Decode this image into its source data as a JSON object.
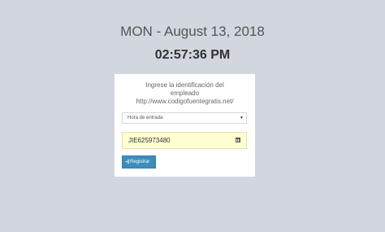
{
  "clock": {
    "date": "MON - August 13, 2018",
    "time": "02:57:36 PM"
  },
  "form": {
    "message_line1": "Ingrese la identificación del",
    "message_line2": "empleado",
    "message_line3": "http://www.codigofuentegratis.net/",
    "select_value": "Hora de entrada",
    "id_value": "JIE625973480",
    "submit_label": "Registrar"
  },
  "icons": {
    "select_caret": "triangle-down",
    "calendar": "calendar-icon",
    "submit": "sign-in-icon"
  },
  "colors": {
    "background": "#d2d6de",
    "button": "#3c8dbc",
    "input_fill": "#ffffd2"
  }
}
